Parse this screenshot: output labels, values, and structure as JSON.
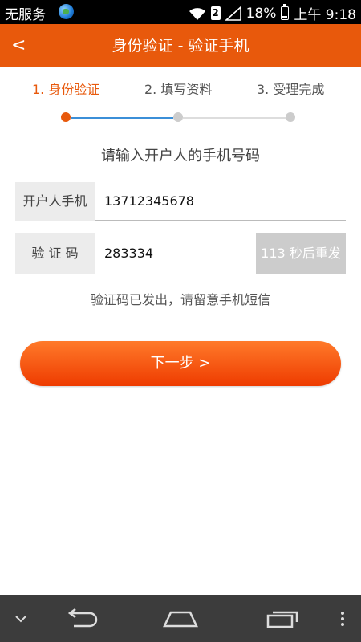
{
  "status_bar": {
    "carrier": "无服务",
    "battery": "18%",
    "time": "上午 9:18",
    "sim_label": "2"
  },
  "header": {
    "back_icon": "<",
    "title": "身份验证 - 验证手机"
  },
  "steps": [
    {
      "label": "1. 身份验证",
      "active": true
    },
    {
      "label": "2. 填写资料",
      "active": false
    },
    {
      "label": "3. 受理完成",
      "active": false
    }
  ],
  "form": {
    "prompt": "请输入开户人的手机号码",
    "phone_label": "开户人手机",
    "phone_value": "13712345678",
    "code_label": "验 证 码",
    "code_value": "283334",
    "resend_label": "113 秒后重发",
    "hint": "验证码已发出，请留意手机短信",
    "next_label": "下一步 >"
  },
  "colors": {
    "accent": "#e8590c",
    "progress": "#3b8fd8",
    "navbar": "#3c3c3c"
  },
  "icons": [
    "globe-icon",
    "wifi-icon",
    "sim-icon",
    "signal-icon",
    "battery-icon",
    "back-icon",
    "chevron-down-icon",
    "nav-back-icon",
    "nav-home-icon",
    "nav-recent-icon",
    "more-icon"
  ]
}
